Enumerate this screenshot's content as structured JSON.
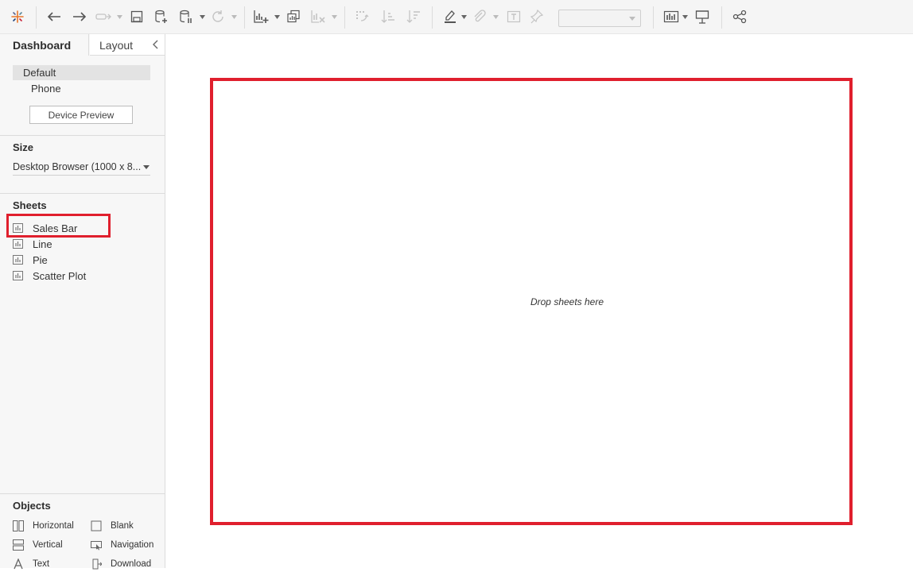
{
  "toolbar": {
    "icons": [
      "tableau-logo-icon",
      "undo-icon",
      "redo-icon",
      "replay-icon",
      "save-icon",
      "new-data-source-icon",
      "pause-updates-icon",
      "refresh-icon",
      "new-worksheet-icon",
      "duplicate-icon",
      "clear-icon",
      "swap-icon",
      "sort-asc-icon",
      "sort-desc-icon",
      "highlight-icon",
      "group-icon",
      "labels-icon",
      "fix-axes-icon",
      "fit-select",
      "show-me-icon",
      "presentation-icon",
      "share-icon"
    ]
  },
  "side_panel": {
    "tabs": {
      "dashboard": "Dashboard",
      "layout": "Layout"
    },
    "device": {
      "default": "Default",
      "phone": "Phone",
      "preview_button": "Device Preview"
    },
    "size": {
      "title": "Size",
      "value": "Desktop Browser (1000 x 8..."
    },
    "sheets": {
      "title": "Sheets",
      "items": [
        {
          "label": "Sales Bar",
          "icon": "worksheet-icon"
        },
        {
          "label": "Line",
          "icon": "worksheet-icon"
        },
        {
          "label": "Pie",
          "icon": "worksheet-icon"
        },
        {
          "label": "Scatter Plot",
          "icon": "worksheet-icon"
        }
      ]
    },
    "objects": {
      "title": "Objects",
      "items": [
        {
          "label": "Horizontal",
          "icon": "horizontal-container-icon"
        },
        {
          "label": "Blank",
          "icon": "blank-icon"
        },
        {
          "label": "Vertical",
          "icon": "vertical-container-icon"
        },
        {
          "label": "Navigation",
          "icon": "navigation-icon"
        },
        {
          "label": "Text",
          "icon": "text-icon"
        },
        {
          "label": "Download",
          "icon": "download-icon"
        }
      ]
    }
  },
  "canvas": {
    "drop_text": "Drop sheets here"
  },
  "colors": {
    "highlight": "#e01f2d",
    "panel_bg": "#f7f7f7",
    "toolbar_bg": "#f5f5f5"
  }
}
